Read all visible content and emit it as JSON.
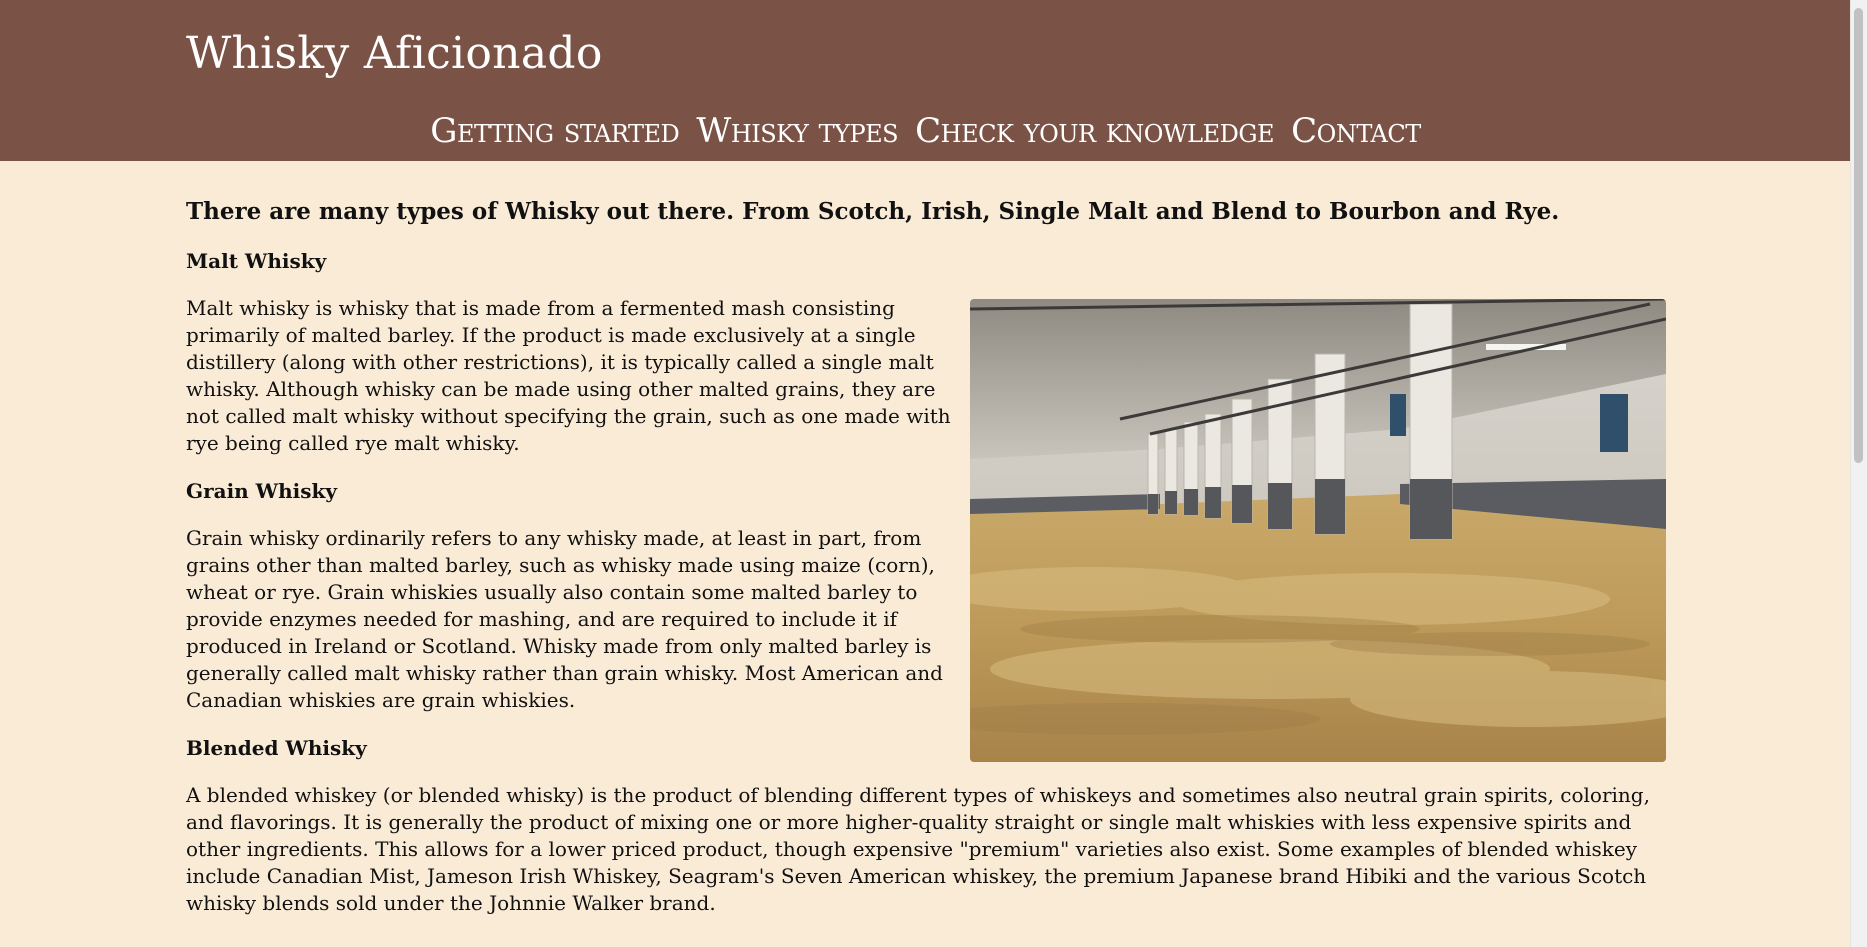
{
  "header": {
    "site_title": "Whisky Aficionado"
  },
  "nav": {
    "items": [
      {
        "label": "Getting started"
      },
      {
        "label": "Whisky types"
      },
      {
        "label": "Check your knowledge"
      },
      {
        "label": "Contact"
      }
    ]
  },
  "main": {
    "intro": "There are many types of Whisky out there. From Scotch, Irish, Single Malt and Blend to Bourbon and Rye.",
    "sections": [
      {
        "heading": "Malt Whisky",
        "text": "Malt whisky is whisky that is made from a fermented mash consisting primarily of malted barley. If the product is made exclusively at a single distillery (along with other restrictions), it is typically called a single malt whisky. Although whisky can be made using other malted grains, they are not called malt whisky without specifying the grain, such as one made with rye being called rye malt whisky."
      },
      {
        "heading": "Grain Whisky",
        "text": "Grain whisky ordinarily refers to any whisky made, at least in part, from grains other than malted barley, such as whisky made using maize (corn), wheat or rye. Grain whiskies usually also contain some malted barley to provide enzymes needed for mashing, and are required to include it if produced in Ireland or Scotland. Whisky made from only malted barley is generally called malt whisky rather than grain whisky. Most American and Canadian whiskies are grain whiskies."
      },
      {
        "heading": "Blended Whisky",
        "text": "A blended whiskey (or blended whisky) is the product of blending different types of whiskeys and sometimes also neutral grain spirits, coloring, and flavorings. It is generally the product of mixing one or more higher-quality straight or single malt whiskies with less expensive spirits and other ingredients. This allows for a lower priced product, though expensive \"premium\" varieties also exist. Some examples of blended whiskey include Canadian Mist, Jameson Irish Whiskey, Seagram's Seven American whiskey, the premium Japanese brand Hibiki and the various Scotch whisky blends sold under the Johnnie Walker brand."
      }
    ]
  },
  "colors": {
    "header_bg": "#7b5246",
    "page_bg": "#faebd7",
    "header_text": "#ffffff"
  }
}
